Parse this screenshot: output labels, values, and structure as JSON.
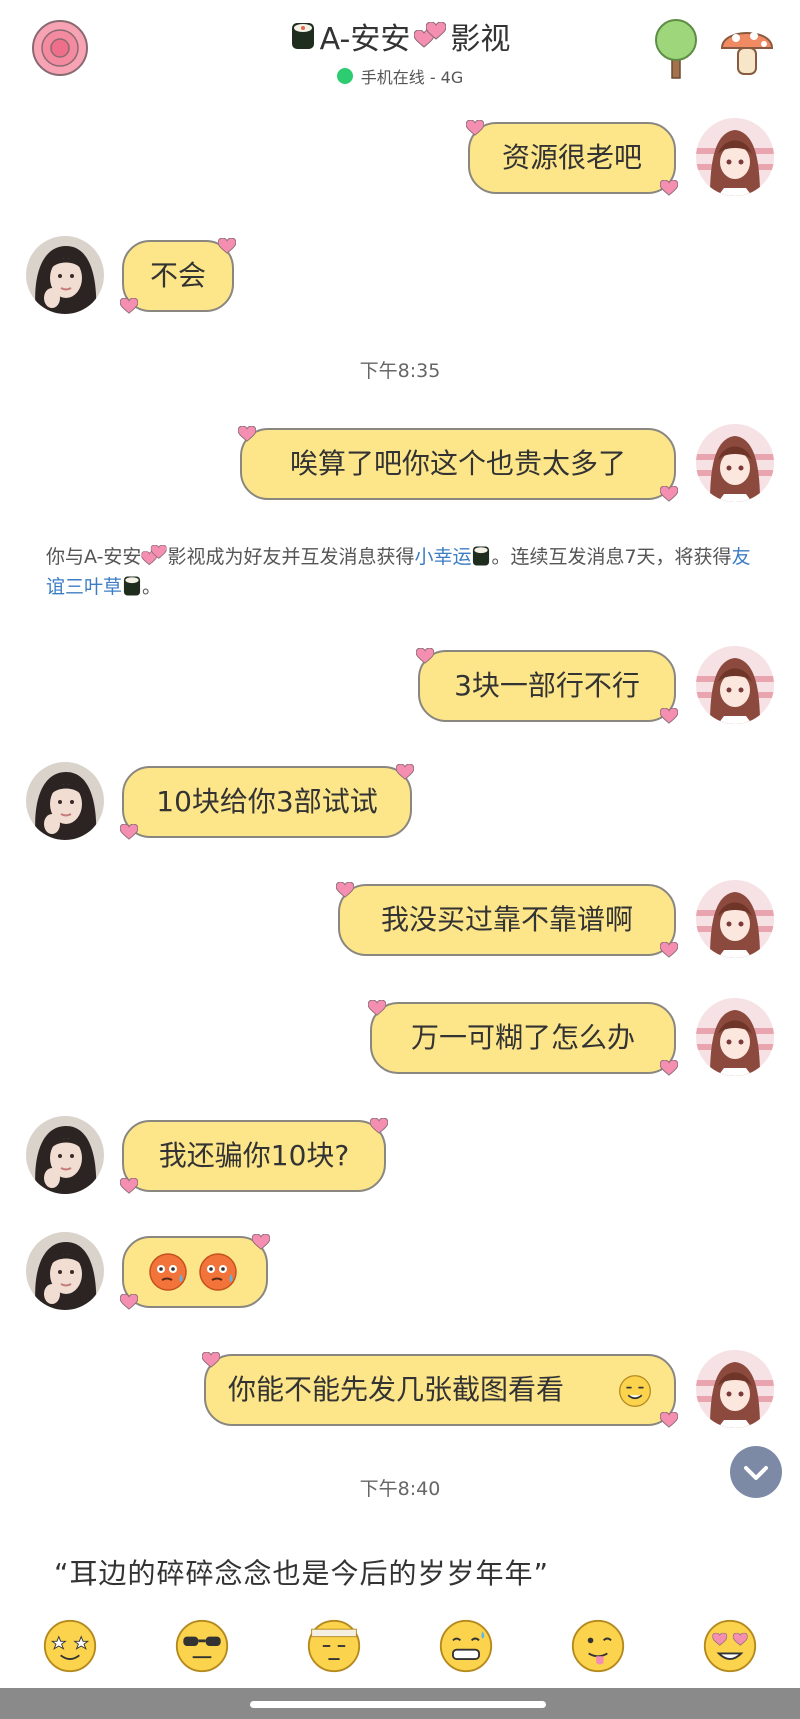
{
  "header": {
    "title": "A-安安",
    "title_suffix": "影视",
    "status": "手机在线 - 4G",
    "colors": {
      "status_dot": "#2ecc71",
      "bubble": "#fde68a",
      "link": "#3b7dc4"
    }
  },
  "messages": [
    {
      "side": "me",
      "text": "资源很老吧"
    },
    {
      "side": "other",
      "text": "不会"
    },
    {
      "side": "me",
      "text": "唉算了吧你这个也贵太多了"
    },
    {
      "side": "me",
      "text": "3块一部行不行"
    },
    {
      "side": "other",
      "text": "10块给你3部试试"
    },
    {
      "side": "me",
      "text": "我没买过靠不靠谱啊"
    },
    {
      "side": "me",
      "text": "万一可糊了怎么办"
    },
    {
      "side": "other",
      "text": "我还骗你10块?"
    },
    {
      "side": "other",
      "text": "",
      "icons": [
        "flushed-sweat-emoji",
        "flushed-sweat-emoji"
      ]
    },
    {
      "side": "me",
      "text": "你能不能先发几张截图看看",
      "icons": [
        "awkward-smile-emoji"
      ]
    }
  ],
  "times": [
    "下午8:35",
    "下午8:40"
  ],
  "system_notice": {
    "part1": "你与A-安安",
    "part2": "影视成为好友并互发消息获得",
    "link1": "小幸运",
    "part3": "。连续互发消息7天，将获得",
    "link2": "友谊三叶草",
    "part4": "。"
  },
  "quote": "“耳边的碎碎念念也是今后的岁岁年年”",
  "emoji_bar": [
    "star-eyes-emoji",
    "sunglasses-emoji",
    "headband-emoji",
    "grin-sweat-emoji",
    "tongue-emoji",
    "heart-eyes-emoji"
  ]
}
